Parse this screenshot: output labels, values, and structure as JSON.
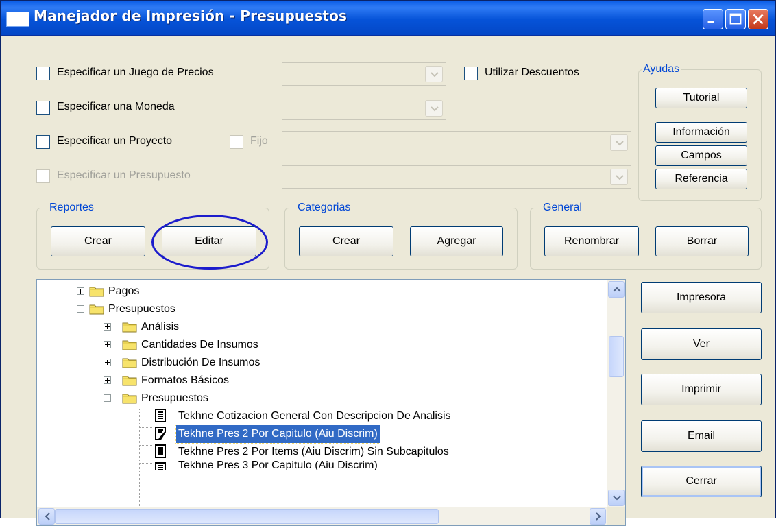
{
  "window": {
    "title": "Manejador de Impresión - Presupuestos"
  },
  "options": {
    "juego_precios": "Especificar un Juego de Precios",
    "moneda": "Especificar una Moneda",
    "proyecto": "Especificar un Proyecto",
    "fijo": "Fijo",
    "presupuesto": "Especificar un Presupuesto",
    "descuentos": "Utilizar Descuentos"
  },
  "ayudas": {
    "legend": "Ayudas",
    "tutorial": "Tutorial",
    "informacion": "Información",
    "campos": "Campos",
    "referencia": "Referencia"
  },
  "reportes": {
    "legend": "Reportes",
    "crear": "Crear",
    "editar": "Editar"
  },
  "categorias": {
    "legend": "Categorias",
    "crear": "Crear",
    "agregar": "Agregar"
  },
  "general": {
    "legend": "General",
    "renombrar": "Renombrar",
    "borrar": "Borrar"
  },
  "side_buttons": {
    "impresora": "Impresora",
    "ver": "Ver",
    "imprimir": "Imprimir",
    "email": "Email",
    "cerrar": "Cerrar"
  },
  "tree": {
    "items": [
      {
        "label": "Pagos",
        "type": "folder",
        "expanded": false
      },
      {
        "label": "Presupuestos",
        "type": "folder",
        "expanded": true
      },
      {
        "label": "Análisis",
        "type": "folder",
        "expanded": false
      },
      {
        "label": "Cantidades De Insumos",
        "type": "folder",
        "expanded": false
      },
      {
        "label": "Distribución De Insumos",
        "type": "folder",
        "expanded": false
      },
      {
        "label": "Formatos Básicos",
        "type": "folder",
        "expanded": false
      },
      {
        "label": "Presupuestos",
        "type": "folder",
        "expanded": true
      },
      {
        "label": "Tekhne Cotizacion General Con Descripcion De Analisis",
        "type": "report"
      },
      {
        "label": "Tekhne Pres 2 Por Capitulo (Aiu Discrim)",
        "type": "report-edit",
        "selected": true
      },
      {
        "label": "Tekhne Pres 2 Por Items (Aiu Discrim) Sin Subcapitulos",
        "type": "report"
      },
      {
        "label": "Tekhne Pres 3 Por Capitulo (Aiu Discrim)",
        "type": "report"
      }
    ]
  },
  "colors": {
    "title_bar": "#0a5ce6",
    "selection": "#316ac5",
    "highlight_circle": "#1c1ccc",
    "group_legend": "#0046d5"
  }
}
